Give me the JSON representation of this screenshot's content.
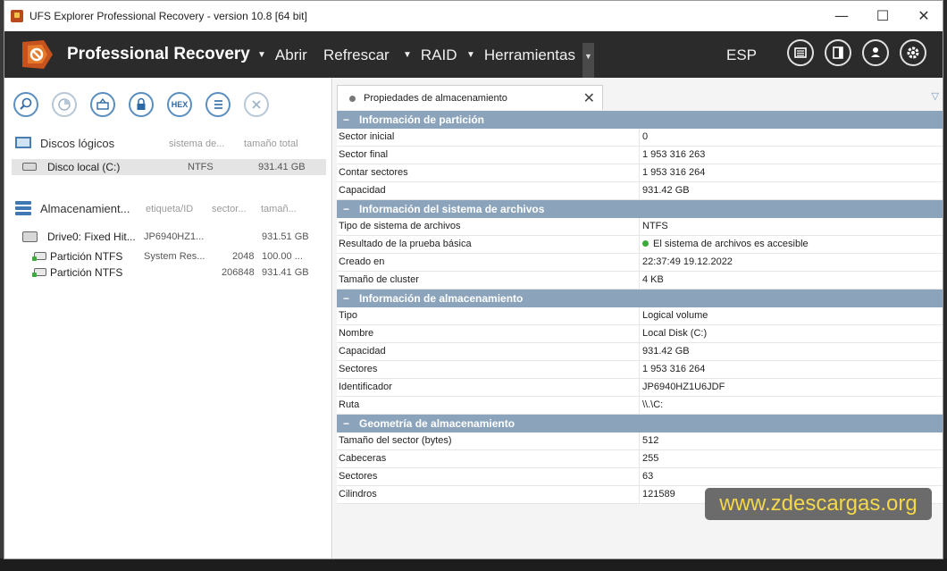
{
  "window": {
    "title": "UFS Explorer Professional Recovery - version 10.8 [64 bit]",
    "controls": {
      "minimize": "—",
      "maximize": "☐",
      "close": "✕"
    }
  },
  "header": {
    "brand": "Professional Recovery",
    "menu": [
      {
        "label": "Abrir",
        "has_caret": true
      },
      {
        "label": "Refrescar",
        "has_caret": false
      },
      {
        "label": "RAID",
        "has_caret": true
      },
      {
        "label": "Herramientas",
        "has_caret": true
      }
    ],
    "language": "ESP",
    "icons": [
      "panel-icon",
      "sidebar-icon",
      "user-icon",
      "settings-icon"
    ]
  },
  "left_pane": {
    "toolbar": [
      "search-icon",
      "scan-icon",
      "image-icon",
      "lock-icon",
      "hex-icon",
      "list-icon",
      "close-icon"
    ],
    "hex_label": "HEX",
    "logical": {
      "title": "Discos lógicos",
      "columns": [
        "sistema de...",
        "tamaño total"
      ],
      "rows": [
        {
          "name": "Disco local (C:)",
          "fs": "NTFS",
          "size": "931.41 GB"
        }
      ]
    },
    "storage": {
      "title": "Almacenamient...",
      "columns": [
        "etiqueta/ID",
        "sector...",
        "tamañ..."
      ],
      "rows": [
        {
          "name": "Drive0: Fixed Hit...",
          "label": "JP6940HZ1...",
          "sector": "",
          "size": "931.51 GB"
        },
        {
          "name": "Partición NTFS",
          "label": "System Res...",
          "sector": "2048",
          "size": "100.00 ..."
        },
        {
          "name": "Partición NTFS",
          "label": "",
          "sector": "206848",
          "size": "931.41 GB"
        }
      ]
    }
  },
  "right_pane": {
    "tab_label": "Propiedades de almacenamiento",
    "groups": [
      {
        "title": "Información de partición",
        "rows": [
          {
            "key": "Sector inicial",
            "value": "0"
          },
          {
            "key": "Sector final",
            "value": "1 953 316 263"
          },
          {
            "key": "Contar sectores",
            "value": "1 953 316 264"
          },
          {
            "key": "Capacidad",
            "value": "931.42 GB"
          }
        ]
      },
      {
        "title": "Información del sistema de archivos",
        "rows": [
          {
            "key": "Tipo de sistema de archivos",
            "value": "NTFS"
          },
          {
            "key": "Resultado de la prueba básica",
            "value": "El sistema de archivos es accesible",
            "status": "ok"
          },
          {
            "key": "Creado en",
            "value": "22:37:49 19.12.2022"
          },
          {
            "key": "Tamaño de cluster",
            "value": "4 KB"
          }
        ]
      },
      {
        "title": "Información de almacenamiento",
        "rows": [
          {
            "key": "Tipo",
            "value": "Logical volume"
          },
          {
            "key": "Nombre",
            "value": "Local Disk (C:)"
          },
          {
            "key": "Capacidad",
            "value": "931.42 GB"
          },
          {
            "key": "Sectores",
            "value": "1 953 316 264"
          },
          {
            "key": "Identificador",
            "value": "JP6940HZ1U6JDF"
          },
          {
            "key": "Ruta",
            "value": "\\\\.\\C:"
          }
        ]
      },
      {
        "title": "Geometría de almacenamiento",
        "rows": [
          {
            "key": "Tamaño del sector (bytes)",
            "value": "512"
          },
          {
            "key": "Cabeceras",
            "value": "255"
          },
          {
            "key": "Sectores",
            "value": "63"
          },
          {
            "key": "Cilindros",
            "value": "121589"
          }
        ]
      }
    ]
  },
  "watermark": "www.zdescargas.org",
  "colors": {
    "header_bg": "#2b2b2b",
    "group_header": "#8ca4bb",
    "accent_blue": "#2d6aa3",
    "ok_green": "#3aaa3a",
    "watermark_text": "#f5d84a"
  }
}
